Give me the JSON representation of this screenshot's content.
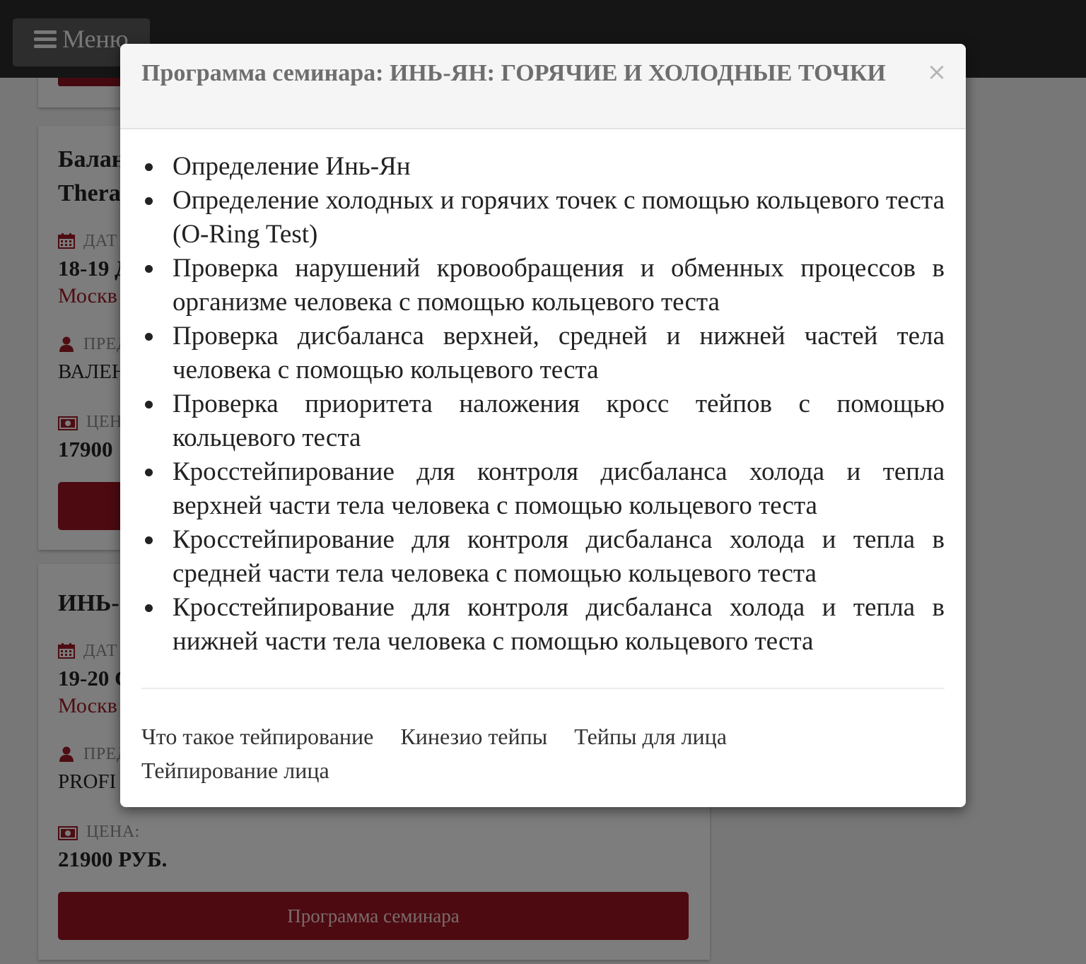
{
  "header": {
    "menu_label": "Меню"
  },
  "background": {
    "cards": [
      {
        "title_lines": [
          "Балан",
          "Thera"
        ],
        "date_label": "ДАТ",
        "date_value": "18-19 Д",
        "city": "Москв",
        "teacher_label": "ПРЕД",
        "teacher_value": "ВАЛЕН",
        "price_label": "ЦЕН",
        "price_value": "17900"
      },
      {
        "title": "ИНЬ-",
        "date_label": "ДАТ",
        "date_value": "19-20 С",
        "city": "Москв",
        "teacher_label": "ПРЕД",
        "teacher_value": "PROFI",
        "price_label": "ЦЕНА:",
        "price_value": "21900 РУБ.",
        "button_label": "Программа семинара"
      }
    ]
  },
  "modal": {
    "title": "Программа семинара: ИНЬ-ЯН: ГОРЯЧИЕ И ХОЛОДНЫЕ ТОЧКИ",
    "close_symbol": "×",
    "items": [
      "Определение Инь-Ян",
      "Определение холодных и горячих точек с помощью кольцевого теста (O-Ring Test)",
      "Проверка нарушений кровообращения и обменных процессов в организме человека с помощью кольцевого теста",
      "Проверка дисбаланса верхней, средней и нижней частей тела человека с помощью кольцевого теста",
      "Проверка приоритета наложения кросс тейпов с помощью кольцевого теста",
      "Кросстейпирование для контроля дисбаланса холода и тепла верхней части тела человека с помощью кольцевого теста",
      "Кросстейпирование для контроля дисбаланса холода и тепла в средней части тела человека с помощью кольцевого теста",
      "Кросстейпирование для контроля дисбаланса холода и тепла в нижней части тела человека с помощью кольцевого теста"
    ],
    "footer_links": [
      "Что такое тейпирование",
      "Кинезио тейпы",
      "Тейпы для лица",
      "Тейпирование лица"
    ]
  },
  "colors": {
    "accent_red": "#9a1420",
    "city_red": "#9c1b24",
    "topbar": "#2b2b2b"
  }
}
